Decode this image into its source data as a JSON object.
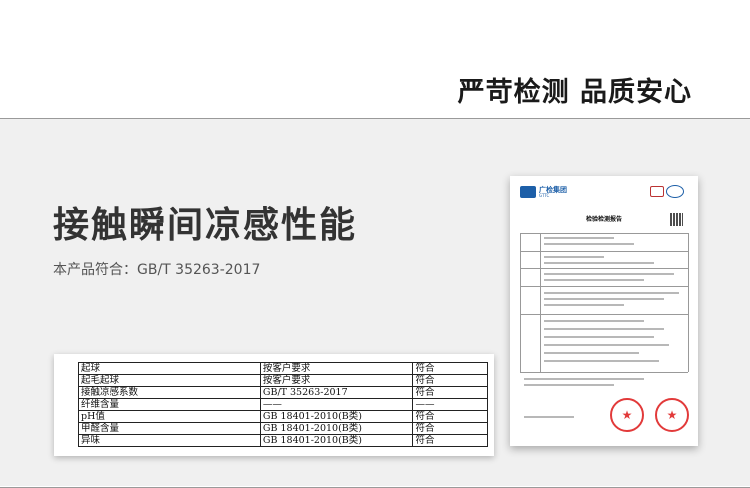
{
  "header": {
    "slogan": "严苛检测  品质安心"
  },
  "feature": {
    "title": "接触瞬间凉感性能",
    "standard_prefix": "本产品符合：",
    "standard_value": "GB/T 35263-2017"
  },
  "results_table": {
    "rows": [
      [
        "起球",
        "按客户要求",
        "符合"
      ],
      [
        "起毛起球",
        "按客户要求",
        "符合"
      ],
      [
        "接触凉感系数",
        "GB/T 35263-2017",
        "符合"
      ],
      [
        "纤维含量",
        "——",
        "——"
      ],
      [
        "pH值",
        "GB 18401-2010(B类)",
        "符合"
      ],
      [
        "甲醛含量",
        "GB 18401-2010(B类)",
        "符合"
      ],
      [
        "异味",
        "GB 18401-2010(B类)",
        "符合"
      ]
    ]
  },
  "report": {
    "org": "广检集团",
    "org_sub": "GTTC",
    "title": "检验检测报告",
    "stamp_glyph": "★"
  },
  "colors": {
    "brand_blue": "#1d5fa8",
    "stamp_red": "#e23a3a",
    "panel_bg": "#f0f0f0"
  }
}
